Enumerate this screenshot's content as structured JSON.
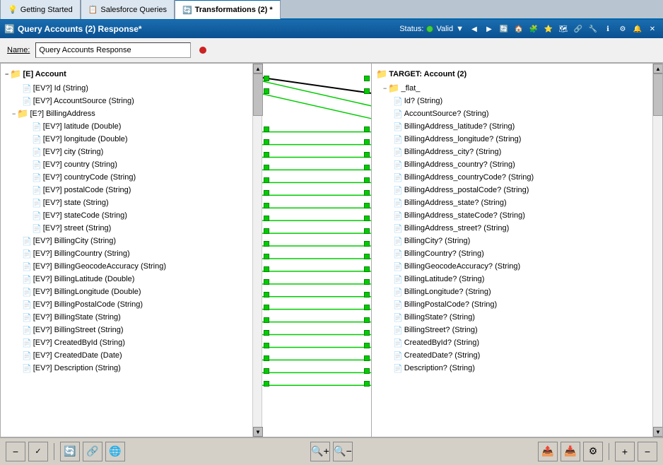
{
  "tabs": [
    {
      "id": "getting-started",
      "label": "Getting Started",
      "icon": "💡",
      "active": false
    },
    {
      "id": "salesforce-queries",
      "label": "Salesforce Queries",
      "icon": "📋",
      "active": false
    },
    {
      "id": "transformations",
      "label": "Transformations (2) *",
      "icon": "🔄",
      "active": true
    }
  ],
  "titleBar": {
    "icon": "🔄",
    "title": "Query Accounts (2) Response*",
    "statusLabel": "Status:",
    "statusValue": "Valid",
    "dropdownIcon": "▼",
    "closeLabel": "✕"
  },
  "nameRow": {
    "label": "Name:",
    "value": "Query Accounts Response"
  },
  "leftPanel": {
    "rootLabel": "[E] Account",
    "items": [
      {
        "indent": 2,
        "type": "doc",
        "label": "[EV?] Id (String)"
      },
      {
        "indent": 2,
        "type": "doc",
        "label": "[EV?] AccountSource (String)"
      },
      {
        "indent": 1,
        "type": "folder",
        "label": "[E?] BillingAddress",
        "expand": true
      },
      {
        "indent": 3,
        "type": "doc",
        "label": "[EV?] latitude (Double)"
      },
      {
        "indent": 3,
        "type": "doc",
        "label": "[EV?] longitude (Double)"
      },
      {
        "indent": 3,
        "type": "doc",
        "label": "[EV?] city (String)"
      },
      {
        "indent": 3,
        "type": "doc",
        "label": "[EV?] country (String)"
      },
      {
        "indent": 3,
        "type": "doc",
        "label": "[EV?] countryCode (String)"
      },
      {
        "indent": 3,
        "type": "doc",
        "label": "[EV?] postalCode (String)"
      },
      {
        "indent": 3,
        "type": "doc",
        "label": "[EV?] state (String)"
      },
      {
        "indent": 3,
        "type": "doc",
        "label": "[EV?] stateCode (String)"
      },
      {
        "indent": 3,
        "type": "doc",
        "label": "[EV?] street (String)"
      },
      {
        "indent": 2,
        "type": "doc",
        "label": "[EV?] BillingCity (String)"
      },
      {
        "indent": 2,
        "type": "doc",
        "label": "[EV?] BillingCountry (String)"
      },
      {
        "indent": 2,
        "type": "doc",
        "label": "[EV?] BillingGeocodeAccuracy (String)"
      },
      {
        "indent": 2,
        "type": "doc",
        "label": "[EV?] BillingLatitude (Double)"
      },
      {
        "indent": 2,
        "type": "doc",
        "label": "[EV?] BillingLongitude (Double)"
      },
      {
        "indent": 2,
        "type": "doc",
        "label": "[EV?] BillingPostalCode (String)"
      },
      {
        "indent": 2,
        "type": "doc",
        "label": "[EV?] BillingState (String)"
      },
      {
        "indent": 2,
        "type": "doc",
        "label": "[EV?] BillingStreet (String)"
      },
      {
        "indent": 2,
        "type": "doc",
        "label": "[EV?] CreatedById (String)"
      },
      {
        "indent": 2,
        "type": "doc",
        "label": "[EV?] CreatedDate (Date)"
      },
      {
        "indent": 2,
        "type": "doc",
        "label": "[EV?] Description (String)"
      }
    ]
  },
  "rightPanel": {
    "rootLabel": "TARGET: Account (2)",
    "subLabel": "_flat_",
    "items": [
      {
        "label": "Id? (String)"
      },
      {
        "label": "AccountSource? (String)"
      },
      {
        "label": "BillingAddress_latitude? (String)"
      },
      {
        "label": "BillingAddress_longitude? (String)"
      },
      {
        "label": "BillingAddress_city? (String)"
      },
      {
        "label": "BillingAddress_country? (String)"
      },
      {
        "label": "BillingAddress_countryCode? (String)"
      },
      {
        "label": "BillingAddress_postalCode? (String)"
      },
      {
        "label": "BillingAddress_state? (String)"
      },
      {
        "label": "BillingAddress_stateCode? (String)"
      },
      {
        "label": "BillingAddress_street? (String)"
      },
      {
        "label": "BillingCity? (String)"
      },
      {
        "label": "BillingCountry? (String)"
      },
      {
        "label": "BillingGeocodeAccuracy? (String)"
      },
      {
        "label": "BillingLatitude? (String)"
      },
      {
        "label": "BillingLongitude? (String)"
      },
      {
        "label": "BillingPostalCode? (String)"
      },
      {
        "label": "BillingState? (String)"
      },
      {
        "label": "BillingStreet? (String)"
      },
      {
        "label": "CreatedById? (String)"
      },
      {
        "label": "CreatedDate? (String)"
      },
      {
        "label": "Description? (String)"
      }
    ]
  },
  "bottomToolbar": {
    "zoomInLabel": "🔍",
    "zoomOutLabel": "🔍"
  },
  "icons": {
    "collapse": "−",
    "expand": "+",
    "folder": "📁",
    "document": "📄",
    "minus": "−",
    "plus": "+",
    "arrow_left": "◀",
    "arrow_right": "▶"
  }
}
